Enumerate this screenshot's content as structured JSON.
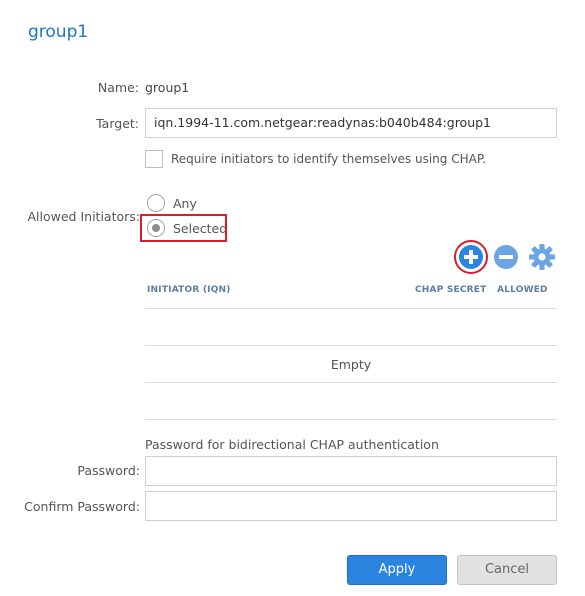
{
  "page": {
    "title": "group1"
  },
  "form": {
    "name_label": "Name:",
    "name_value": "group1",
    "target_label": "Target:",
    "target_value": "iqn.1994-11.com.netgear:readynas:b040b484:group1",
    "chap_checkbox_label": "Require initiators to identify themselves using CHAP.",
    "chap_checkbox_checked": false,
    "allowed_initiators_label": "Allowed Initiators:",
    "option_any": "Any",
    "option_selected": "Selected",
    "selected_option": "Selected"
  },
  "table": {
    "col_initiator": "INITIATOR (IQN)",
    "col_chap_secret": "CHAP SECRET",
    "col_allowed": "ALLOWED",
    "empty_text": "Empty"
  },
  "toolbar": {
    "add_icon": "plus-circle-icon",
    "remove_icon": "minus-circle-icon",
    "settings_icon": "gear-icon"
  },
  "bidirectional": {
    "heading": "Password for bidirectional CHAP authentication",
    "password_label": "Password:",
    "password_value": "",
    "confirm_label": "Confirm Password:",
    "confirm_value": ""
  },
  "buttons": {
    "apply": "Apply",
    "cancel": "Cancel"
  },
  "colors": {
    "accent": "#2b84e0",
    "title": "#1a75c9",
    "highlight": "#d81e2b",
    "header_text": "#5d7ea3"
  }
}
